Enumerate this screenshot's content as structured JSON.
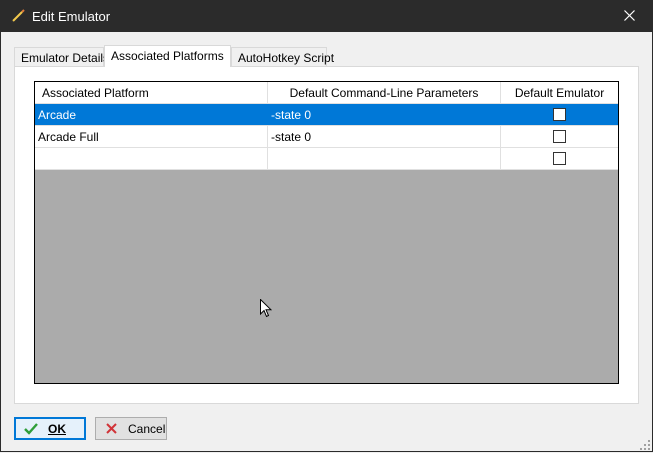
{
  "window": {
    "title": "Edit Emulator",
    "icon": "pencil-icon"
  },
  "tabs": [
    {
      "label": "Emulator Details",
      "active": false
    },
    {
      "label": "Associated Platforms",
      "active": true
    },
    {
      "label": "AutoHotkey Script",
      "active": false
    }
  ],
  "grid": {
    "columns": [
      "Associated Platform",
      "Default Command-Line Parameters",
      "Default Emulator"
    ],
    "rows": [
      {
        "platform": "Arcade",
        "params": "-state 0",
        "default": false,
        "selected": true
      },
      {
        "platform": "Arcade Full",
        "params": "-state 0",
        "default": false,
        "selected": false
      },
      {
        "platform": "",
        "params": "",
        "default": false,
        "selected": false
      }
    ]
  },
  "buttons": {
    "ok": {
      "label": "OK",
      "icon": "check-icon"
    },
    "cancel": {
      "label": "Cancel",
      "icon": "x-icon"
    }
  },
  "colors": {
    "titlebar": "#2b2b2b",
    "selection": "#0078d7",
    "grid_background": "#ababab"
  }
}
